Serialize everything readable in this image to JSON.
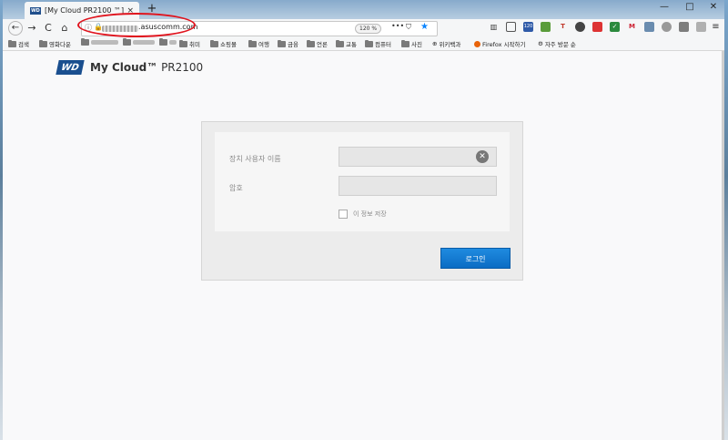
{
  "browser": {
    "tab_title": "[My Cloud PR2100 ™]",
    "tab_close": "×",
    "new_tab": "+",
    "window_controls": [
      "—",
      "□",
      "✕"
    ],
    "url_domain": ".asuscomm.com",
    "zoom": "120 %",
    "url_actions": [
      "•••",
      "⛉",
      "★"
    ],
    "nav": [
      "←",
      "→",
      "C",
      "⌂"
    ],
    "extensions": [
      "120",
      "T",
      "M"
    ],
    "menu": "≡"
  },
  "bookmarks": [
    "검색",
    "영화다운",
    "",
    "",
    "",
    "취미",
    "쇼핑몰",
    "여행",
    "금융",
    "언론",
    "교통",
    "컴퓨터",
    "사진",
    "위키백과",
    "Firefox 시작하기",
    "자주 방문 순"
  ],
  "app": {
    "logo": "WD",
    "brand": "My Cloud™",
    "model": " PR2100"
  },
  "login": {
    "username_label": "장치 사용자 이름",
    "password_label": "암호",
    "remember_label": "이 정보 저장",
    "login_button": "로그인",
    "username_value": "",
    "password_value": ""
  }
}
